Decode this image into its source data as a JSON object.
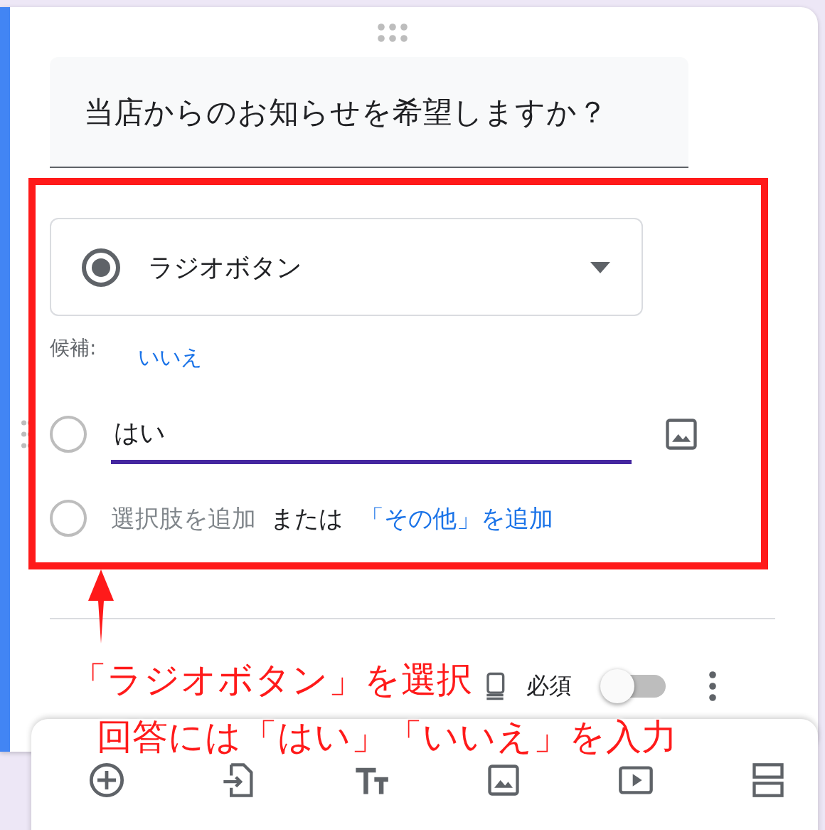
{
  "question": {
    "title": "当店からのお知らせを希望しますか？"
  },
  "type_dropdown": {
    "label": "ラジオボタン"
  },
  "suggestion": {
    "label": "候補:",
    "link": "いいえ"
  },
  "options": [
    {
      "value": "はい",
      "focused": true
    }
  ],
  "add_option": {
    "placeholder": "選択肢を追加",
    "separator": "または",
    "other_link": "「その他」を追加"
  },
  "footer": {
    "required_label": "必須",
    "required_on": false
  },
  "annotations": [
    {
      "text": "「ラジオボタン」を選択"
    },
    {
      "text": "回答には「はい」「いいえ」を入力"
    }
  ]
}
